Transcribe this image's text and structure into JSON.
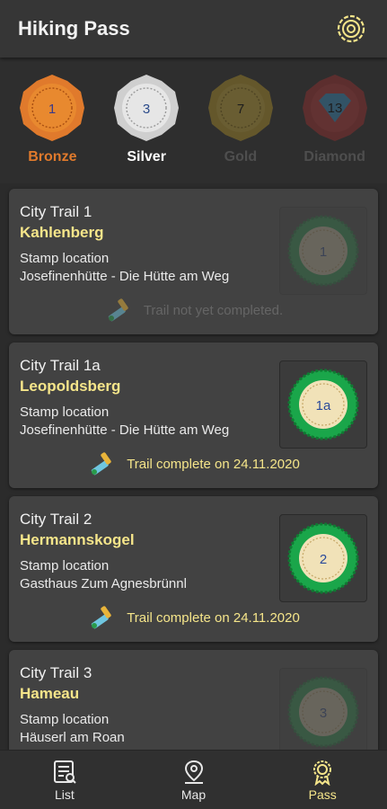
{
  "app": {
    "title": "Hiking Pass"
  },
  "colors": {
    "accent_yellow": "#f5e58a",
    "bronze": "#e07a2c",
    "silver": "#d6d6d6",
    "gold": "#c9a528",
    "diamond": "#b33030",
    "stamp_green": "#1aa64a"
  },
  "icons": {
    "settings": "settings-icon",
    "list": "list-icon",
    "map": "map-pin-icon",
    "pass": "award-icon",
    "hammer": "hammer-icon"
  },
  "medals": [
    {
      "label": "Bronze",
      "count": "1",
      "label_color": "#e07a2c"
    },
    {
      "label": "Silver",
      "count": "3",
      "label_color": "#ffffff"
    },
    {
      "label": "Gold",
      "count": "7",
      "label_color": "#8a8a8a"
    },
    {
      "label": "Diamond",
      "count": "13",
      "label_color": "#8a8a8a"
    }
  ],
  "trails": [
    {
      "city": "City Trail 1",
      "name": "Kahlenberg",
      "stamp_label": "Stamp location",
      "stamp_location": "Josefinenhütte - Die Hütte am Weg",
      "stamp_number": "1",
      "completed": false,
      "status": "Trail not yet completed."
    },
    {
      "city": "City Trail 1a",
      "name": "Leopoldsberg",
      "stamp_label": "Stamp location",
      "stamp_location": "Josefinenhütte - Die Hütte am Weg",
      "stamp_number": "1a",
      "completed": true,
      "status": "Trail complete on 24.11.2020"
    },
    {
      "city": "City Trail 2",
      "name": "Hermannskogel",
      "stamp_label": "Stamp location",
      "stamp_location": "Gasthaus Zum Agnesbrünnl",
      "stamp_number": "2",
      "completed": true,
      "status": "Trail complete on 24.11.2020"
    },
    {
      "city": "City Trail 3",
      "name": "Hameau",
      "stamp_label": "Stamp location",
      "stamp_location": "Häuserl am Roan",
      "stamp_number": "3",
      "completed": false,
      "status": ""
    }
  ],
  "nav": [
    {
      "label": "List",
      "active": false
    },
    {
      "label": "Map",
      "active": false
    },
    {
      "label": "Pass",
      "active": true
    }
  ]
}
